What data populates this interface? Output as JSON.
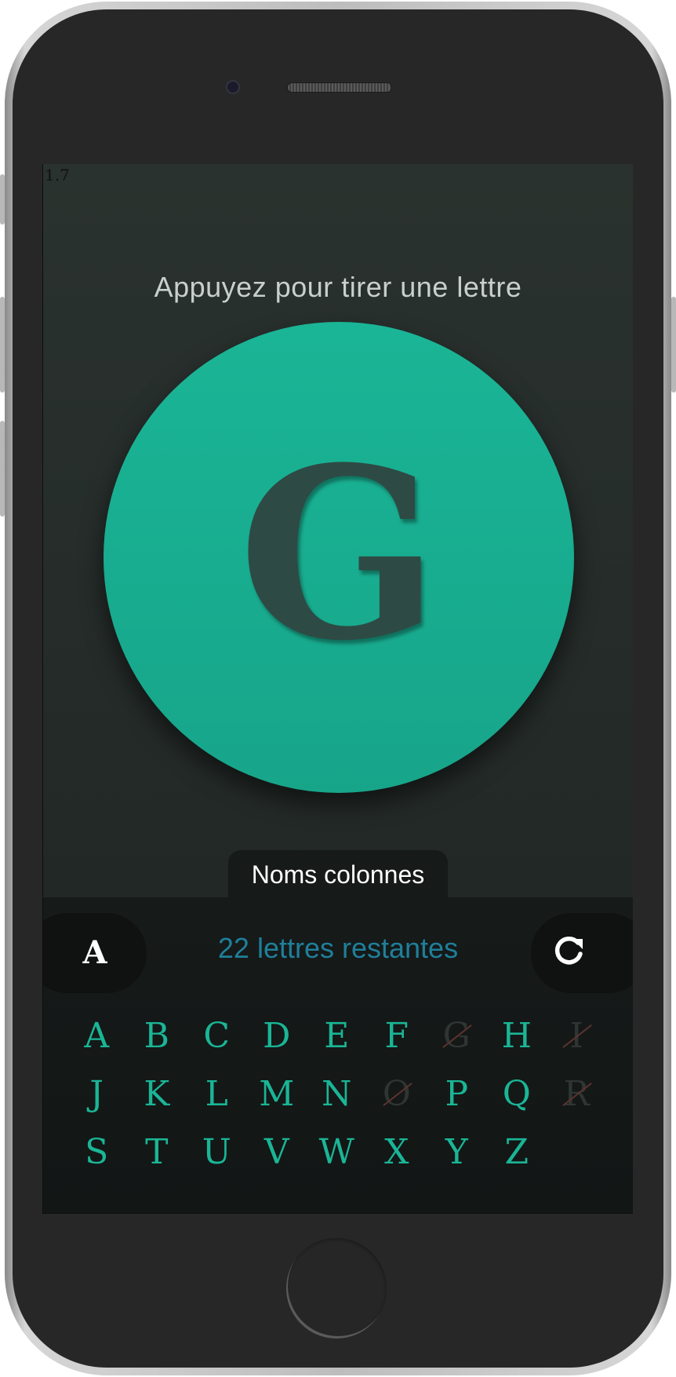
{
  "version": "1.7",
  "prompt": "Appuyez pour tirer une lettre",
  "current_letter": "G",
  "category": "Noms colonnes",
  "mode_button_label": "A",
  "remaining_text": "22 lettres restantes",
  "reset_icon": "refresh-icon",
  "colors": {
    "accent": "#1ab596",
    "remaining_text": "#1f7f9a",
    "used_letter": "#2f3533",
    "strike": "#5a3330"
  },
  "letters": [
    {
      "letter": "A",
      "used": false
    },
    {
      "letter": "B",
      "used": false
    },
    {
      "letter": "C",
      "used": false
    },
    {
      "letter": "D",
      "used": false
    },
    {
      "letter": "E",
      "used": false
    },
    {
      "letter": "F",
      "used": false
    },
    {
      "letter": "G",
      "used": true
    },
    {
      "letter": "H",
      "used": false
    },
    {
      "letter": "I",
      "used": true
    },
    {
      "letter": "J",
      "used": false
    },
    {
      "letter": "K",
      "used": false
    },
    {
      "letter": "L",
      "used": false
    },
    {
      "letter": "M",
      "used": false
    },
    {
      "letter": "N",
      "used": false
    },
    {
      "letter": "O",
      "used": true
    },
    {
      "letter": "P",
      "used": false
    },
    {
      "letter": "Q",
      "used": false
    },
    {
      "letter": "R",
      "used": true
    },
    {
      "letter": "S",
      "used": false
    },
    {
      "letter": "T",
      "used": false
    },
    {
      "letter": "U",
      "used": false
    },
    {
      "letter": "V",
      "used": false
    },
    {
      "letter": "W",
      "used": false
    },
    {
      "letter": "X",
      "used": false
    },
    {
      "letter": "Y",
      "used": false
    },
    {
      "letter": "Z",
      "used": false
    }
  ]
}
